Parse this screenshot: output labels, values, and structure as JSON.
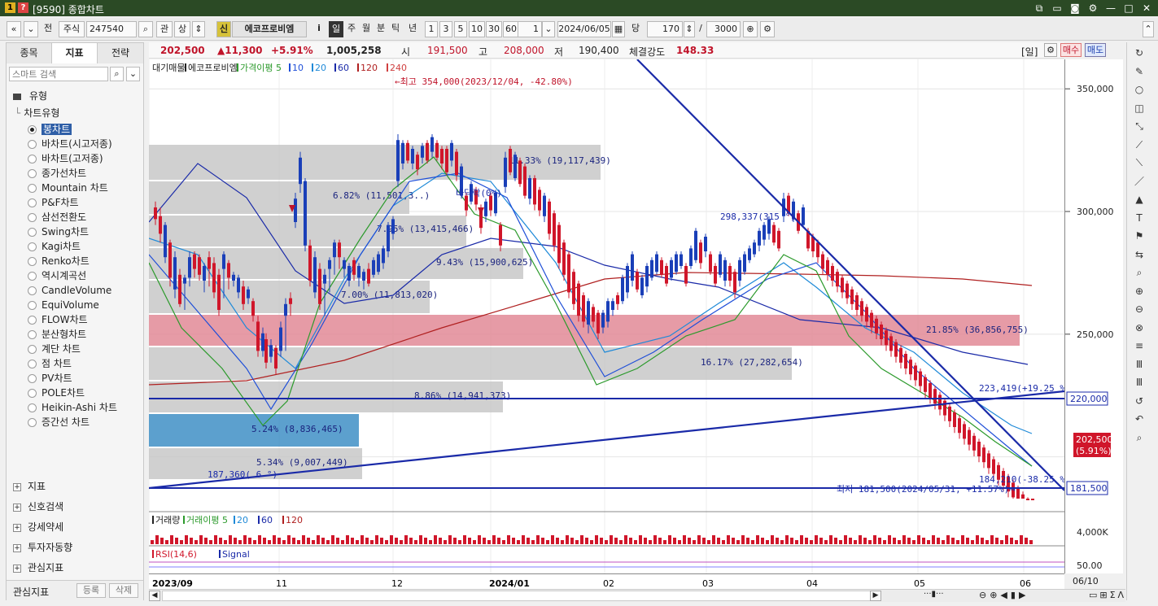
{
  "window": {
    "title": "[9590] 종합차트",
    "icon_a": "1",
    "icon_b": "?"
  },
  "window_controls": [
    "restore-icon",
    "minimize-icon",
    "camera-icon",
    "settings-icon",
    "minus-icon",
    "maximize-icon",
    "close-icon"
  ],
  "toolbar": {
    "market": "주식",
    "code": "247540",
    "btn_gwan": "관",
    "btn_sang": "상",
    "badge": "신",
    "stock_name": "에코프로비엠",
    "info": "i",
    "periods": [
      "일",
      "주",
      "월",
      "분",
      "틱",
      "년"
    ],
    "active_period": "일",
    "intervals": [
      "1",
      "3",
      "5",
      "10",
      "30",
      "60"
    ],
    "interval_value": "1",
    "date": "2024/06/05",
    "dang": "당",
    "count": "170",
    "slash": "/",
    "total": "3000",
    "jeon": "전"
  },
  "sidebar": {
    "tabs": [
      "종목",
      "지표",
      "전략"
    ],
    "active_tab": "지표",
    "search_placeholder": "스마트 검색",
    "section": "유형",
    "subsection": "차트유형",
    "items": [
      "봉차트",
      "바차트(시고저종)",
      "바차트(고저종)",
      "종가선차트",
      "Mountain 차트",
      "P&F차트",
      "삼선전환도",
      "Swing차트",
      "Kagi차트",
      "Renko차트",
      "역시계곡선",
      "CandleVolume",
      "EquiVolume",
      "FLOW차트",
      "분산형차트",
      "계단 차트",
      "점 차트",
      "PV차트",
      "POLE차트",
      "Heikin-Ashi 차트",
      "증간선 차트"
    ],
    "groups": [
      "지표",
      "신호검색",
      "강세약세",
      "투자자동향",
      "관심지표"
    ],
    "footer": {
      "label": "관심지표",
      "add": "등록",
      "delete": "삭제"
    }
  },
  "quote": {
    "price": "202,500",
    "change": "▲11,300",
    "change_pct": "+5.91%",
    "volume": "1,005,258",
    "open_label": "시",
    "open": "191,500",
    "high_label": "고",
    "high": "208,000",
    "low_label": "저",
    "low": "190,400",
    "strength_label": "체결강도",
    "strength": "148.33",
    "period_tag": "[일]",
    "buy": "매수",
    "sell": "매도"
  },
  "legend": {
    "items": [
      "대기매물",
      "에코프로비엠",
      "가격이평 5",
      "10",
      "20",
      "60",
      "120",
      "240"
    ],
    "colors": [
      "#222222",
      "#222222",
      "#2c9a2c",
      "#1f4fd8",
      "#1f8ad8",
      "#1a2aa8",
      "#b02020",
      "#d04040"
    ]
  },
  "chart_data": {
    "type": "candlestick",
    "title": "에코프로비엠",
    "y_ticks": [
      "350,000",
      "300,000",
      "250,000"
    ],
    "ylim": [
      178000,
      362000
    ],
    "x_ticks": [
      "2023/09",
      "11",
      "12",
      "2024/01",
      "02",
      "03",
      "04",
      "05",
      "06",
      "06/10"
    ],
    "annotations": [
      "←최고 354,000(2023/12/04, -42.80%)",
      "최저 181,500(2024/05/31, +11.57%)⟶",
      "298,337(315 °)",
      "223,419(+19.25 %)",
      "184,210(-38.25 %)",
      "187,360( 6 °)",
      "바닥락(0%)"
    ],
    "price_marks": [
      "220,000",
      "202,500",
      "(5.91%)",
      "181,500"
    ],
    "volume_profile": [
      {
        "label": "11.33% (19,117,439)"
      },
      {
        "label": "6.82% (11,501,3..)"
      },
      {
        "label": "7.95% (13,415,466)"
      },
      {
        "label": "9.43% (15,900,625)"
      },
      {
        "label": "7.00% (11,813,020)"
      },
      {
        "label": "21.85% (36,856,755)"
      },
      {
        "label": "16.17% (27,282,654)"
      },
      {
        "label": "8.86% (14,941,373)"
      },
      {
        "label": "5.24% (8,836,465)"
      },
      {
        "label": "5.34% (9,007,449)"
      }
    ],
    "volume_panel": {
      "legend": [
        "거래량",
        "거래이평 5",
        "20",
        "60",
        "120"
      ],
      "tick": "4,000K"
    },
    "rsi_panel": {
      "legend": [
        "RSI(14,6)",
        "Signal"
      ],
      "tick": "50.00"
    }
  },
  "bottom": {
    "icons": [
      "scroll-left-icon",
      "scroll-right-icon",
      "zoom-in-icon",
      "zoom-out-icon",
      "play-icon",
      "pause-icon"
    ]
  }
}
